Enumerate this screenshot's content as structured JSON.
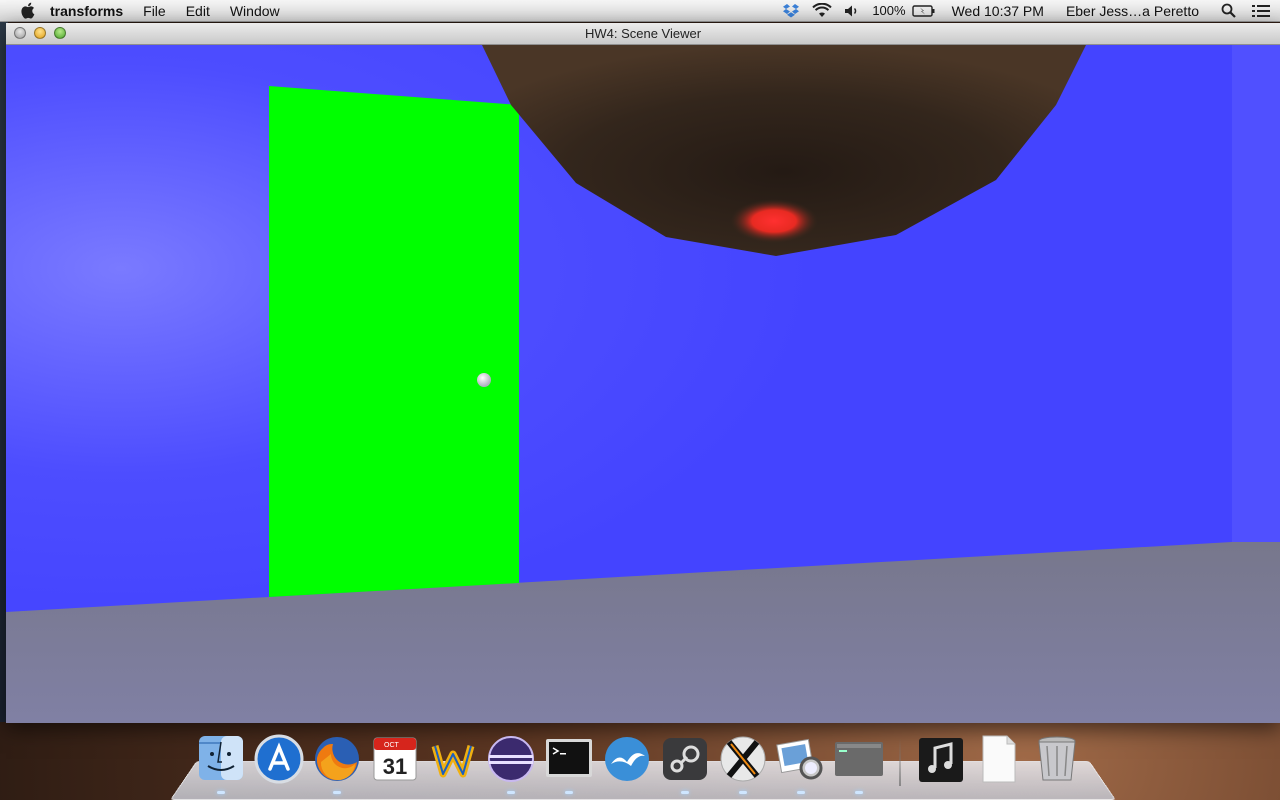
{
  "menubar": {
    "app_name": "transforms",
    "menus": [
      "File",
      "Edit",
      "Window"
    ],
    "battery": "100%",
    "clock": "Wed 10:37 PM",
    "user": "Eber Jess…a Peretto"
  },
  "window": {
    "title": "HW4: Scene Viewer"
  },
  "scene": {
    "wall_color": "#4444ff",
    "floor_color": "#7a7a92",
    "door_color": "#00ff00",
    "sphere_color": "#3a2a1e",
    "light_color": "#ff2a2a"
  },
  "dock": {
    "apps": [
      {
        "name": "Finder",
        "icon": "finder-icon"
      },
      {
        "name": "App Store",
        "icon": "app-store-icon"
      },
      {
        "name": "Firefox",
        "icon": "firefox-icon"
      },
      {
        "name": "iCal",
        "icon": "calendar-icon",
        "month": "OCT",
        "day": "31"
      },
      {
        "name": "Wunderlist",
        "icon": "wunderlist-icon"
      },
      {
        "name": "Eclipse",
        "icon": "eclipse-icon"
      },
      {
        "name": "Terminal",
        "icon": "terminal-icon"
      },
      {
        "name": "OpenOffice",
        "icon": "openoffice-icon"
      },
      {
        "name": "Steam",
        "icon": "steam-icon"
      },
      {
        "name": "X11",
        "icon": "x11-icon"
      },
      {
        "name": "Preview",
        "icon": "preview-icon"
      },
      {
        "name": "transforms",
        "icon": "console-window-icon"
      },
      {
        "name": "iTunes",
        "icon": "itunes-icon"
      },
      {
        "name": "Document",
        "icon": "document-icon"
      },
      {
        "name": "Trash",
        "icon": "trash-icon"
      }
    ]
  }
}
